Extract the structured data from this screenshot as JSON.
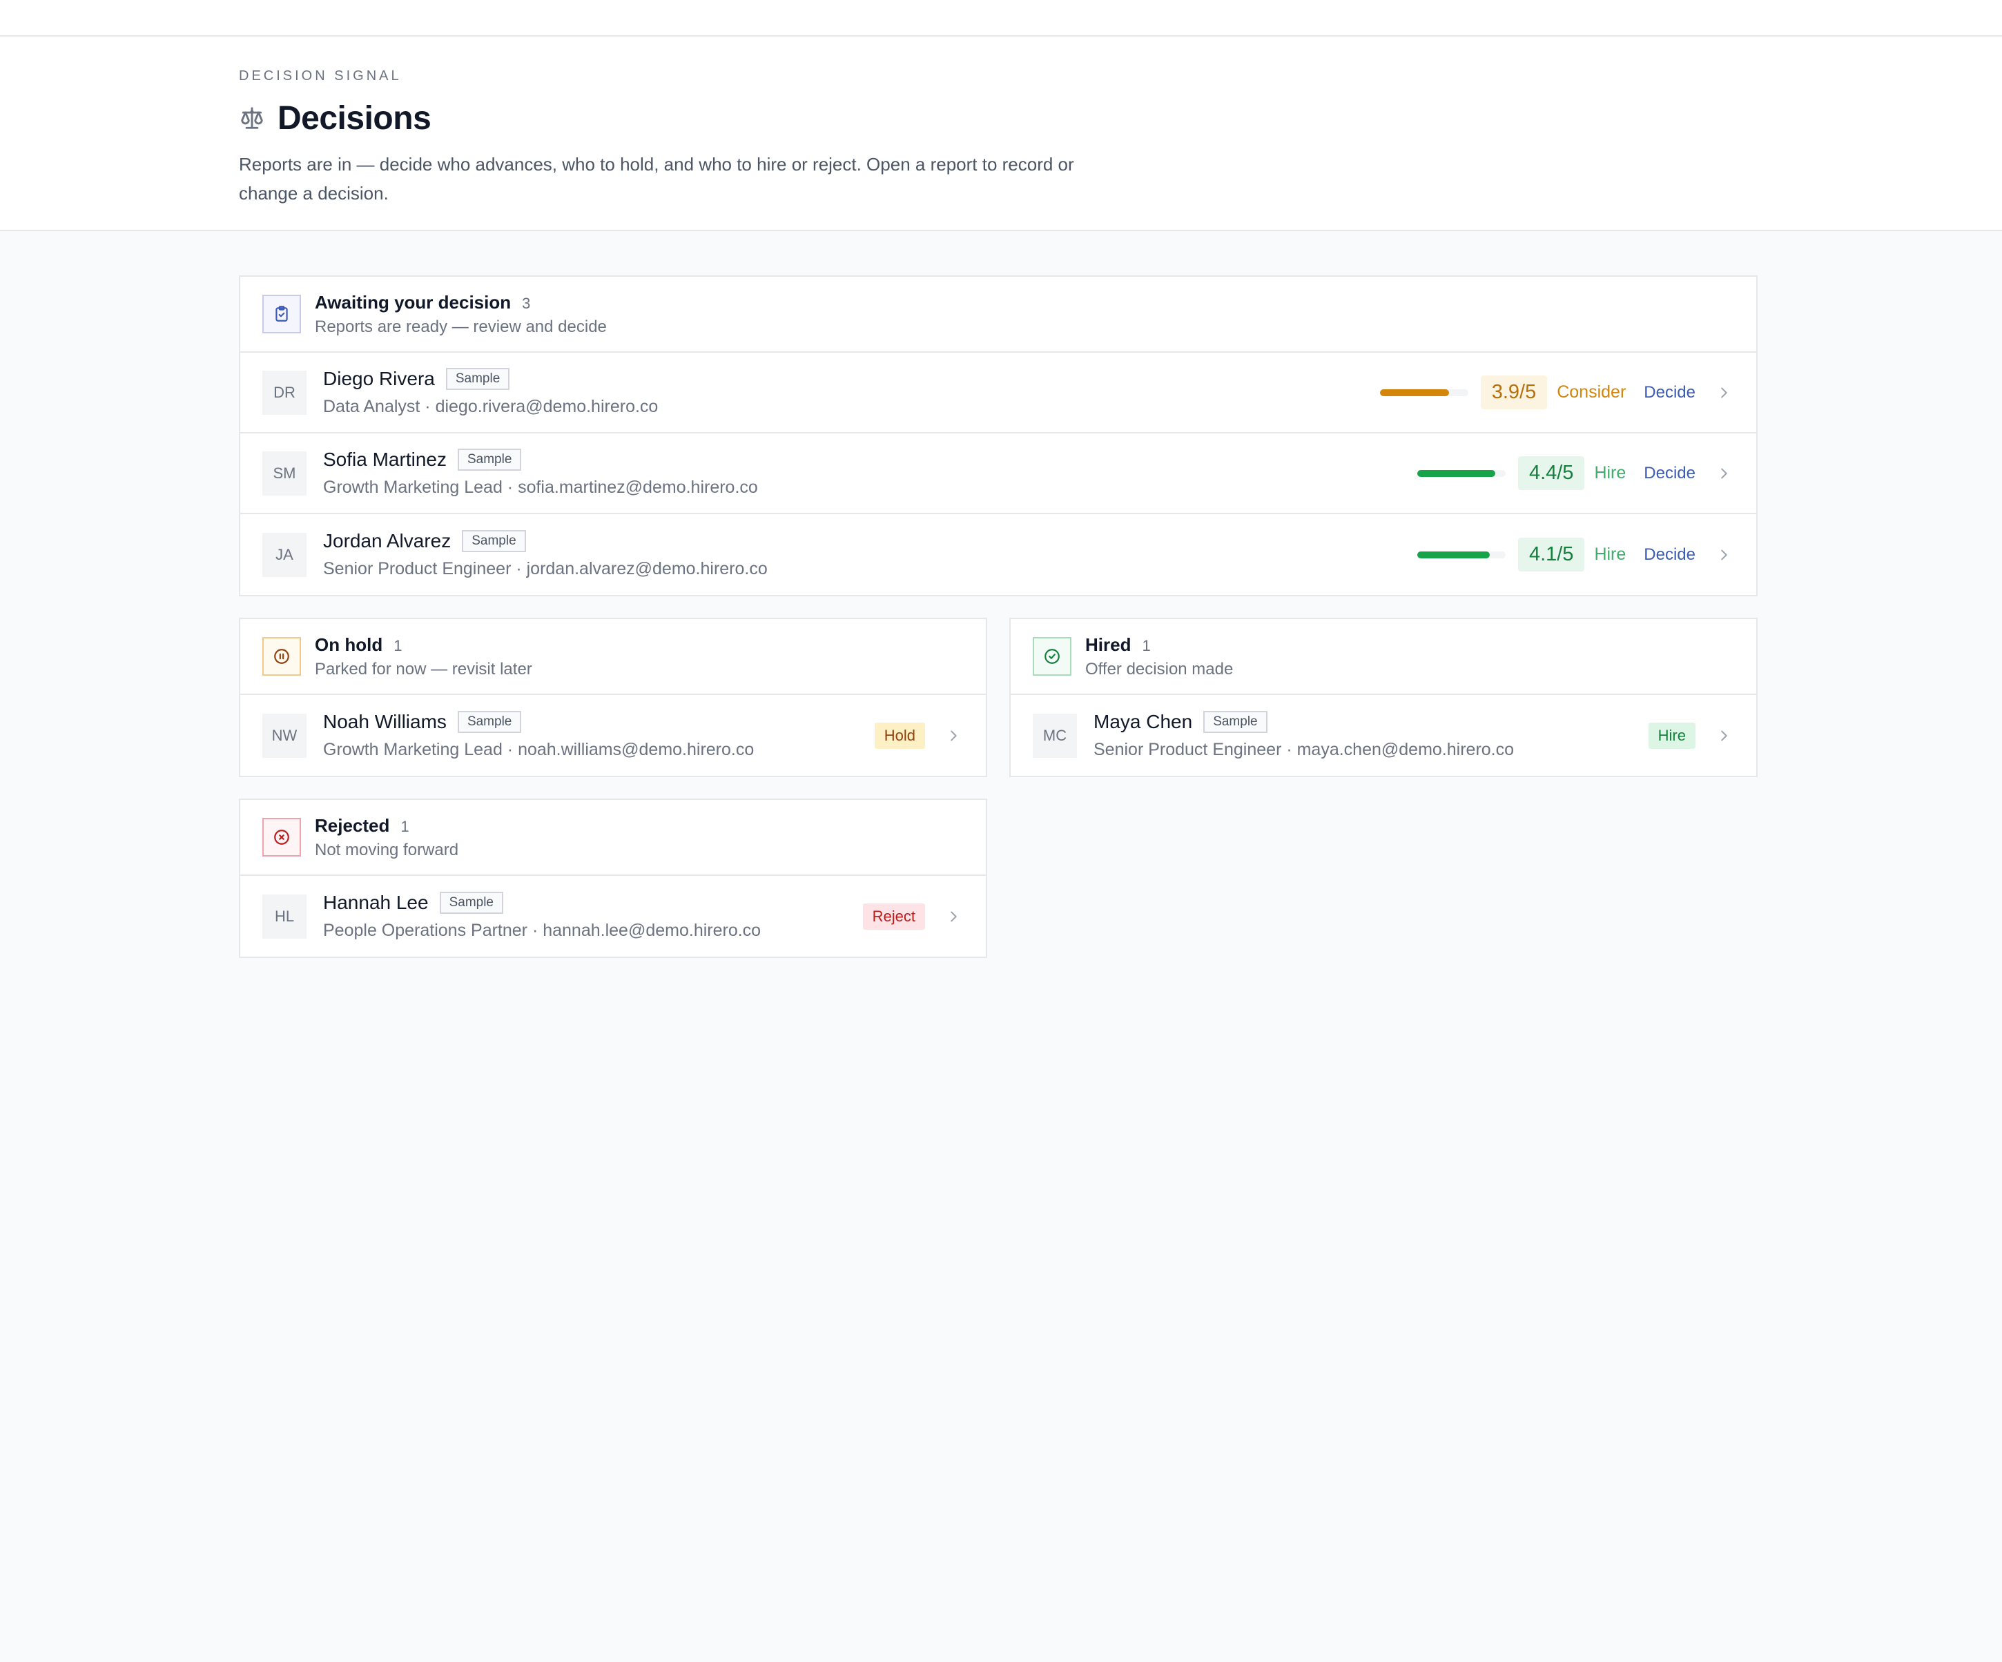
{
  "header": {
    "eyebrow": "DECISION SIGNAL",
    "title": "Decisions",
    "description": "Reports are in — decide who advances, who to hold, and who to hire or reject. Open a report to record or change a decision."
  },
  "colors": {
    "consider": "#d4860b",
    "consider_bg": "#fdf3e1",
    "hire": "#16a34a",
    "hire_bg": "#e6f6ec",
    "hold": "#92400e",
    "hold_bg": "#fdf0c4",
    "reject": "#b91c1c",
    "reject_bg": "#fde3e6",
    "accent_link": "#3b5bb5"
  },
  "awaiting": {
    "icon": "clipboard-check-icon",
    "title": "Awaiting your decision",
    "count": "3",
    "subtitle": "Reports are ready — review and decide",
    "rows": [
      {
        "initials": "DR",
        "name": "Diego Rivera",
        "badge": "Sample",
        "meta": "Data Analyst · diego.rivera@demo.hirero.co",
        "score": "3.9/5",
        "score_fraction": 0.78,
        "verdict": "Consider",
        "decide": "Decide"
      },
      {
        "initials": "SM",
        "name": "Sofia Martinez",
        "badge": "Sample",
        "meta": "Growth Marketing Lead · sofia.martinez@demo.hirero.co",
        "score": "4.4/5",
        "score_fraction": 0.88,
        "verdict": "Hire",
        "decide": "Decide"
      },
      {
        "initials": "JA",
        "name": "Jordan Alvarez",
        "badge": "Sample",
        "meta": "Senior Product Engineer · jordan.alvarez@demo.hirero.co",
        "score": "4.1/5",
        "score_fraction": 0.82,
        "verdict": "Hire",
        "decide": "Decide"
      }
    ]
  },
  "on_hold": {
    "icon": "pause-circle-icon",
    "title": "On hold",
    "count": "1",
    "subtitle": "Parked for now — revisit later",
    "rows": [
      {
        "initials": "NW",
        "name": "Noah Williams",
        "badge": "Sample",
        "meta": "Growth Marketing Lead · noah.williams@demo.hirero.co",
        "status": "Hold"
      }
    ]
  },
  "hired": {
    "icon": "check-circle-icon",
    "title": "Hired",
    "count": "1",
    "subtitle": "Offer decision made",
    "rows": [
      {
        "initials": "MC",
        "name": "Maya Chen",
        "badge": "Sample",
        "meta": "Senior Product Engineer · maya.chen@demo.hirero.co",
        "status": "Hire"
      }
    ]
  },
  "rejected": {
    "icon": "x-circle-icon",
    "title": "Rejected",
    "count": "1",
    "subtitle": "Not moving forward",
    "rows": [
      {
        "initials": "HL",
        "name": "Hannah Lee",
        "badge": "Sample",
        "meta": "People Operations Partner · hannah.lee@demo.hirero.co",
        "status": "Reject"
      }
    ]
  }
}
